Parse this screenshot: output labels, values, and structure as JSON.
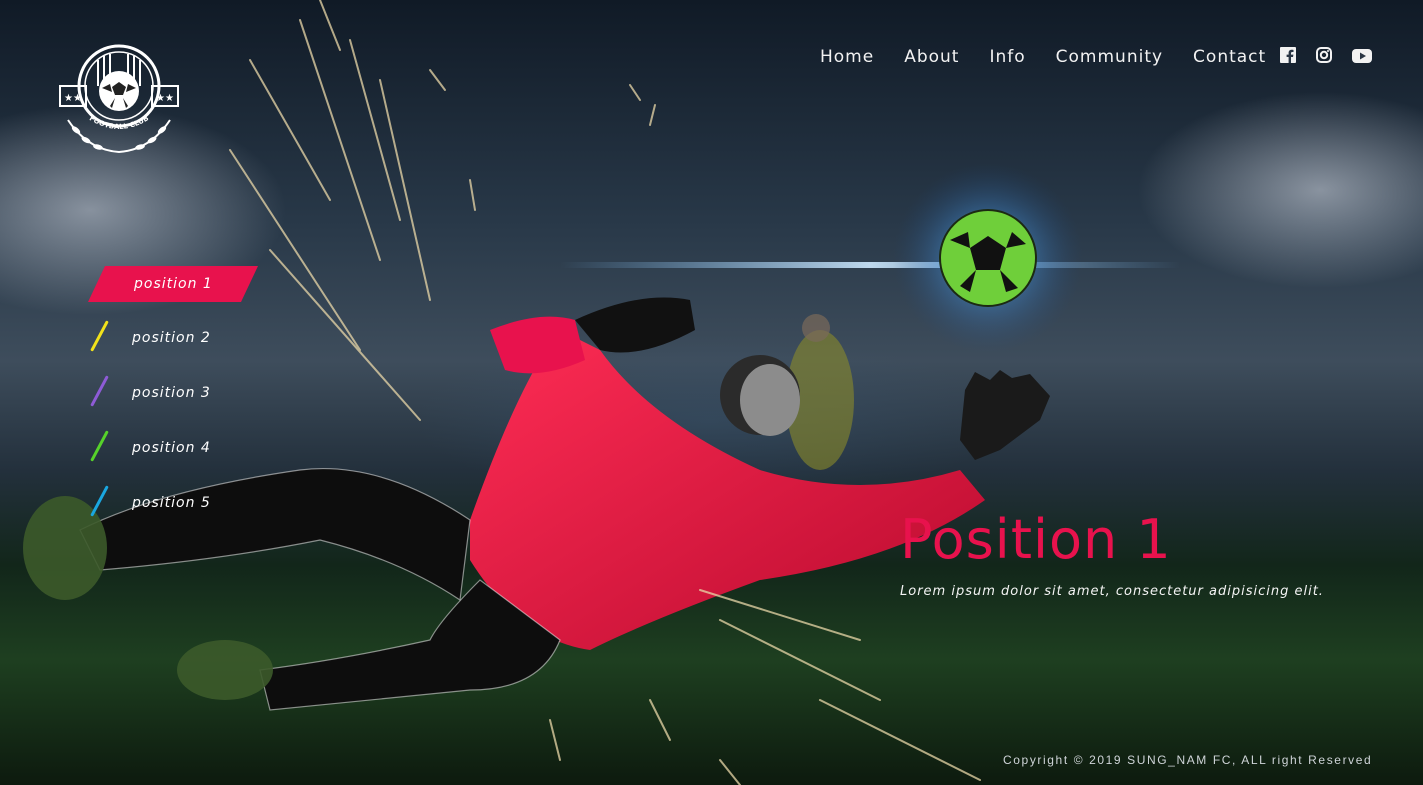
{
  "brand": {
    "logo_text": "FOOTBALL CLUB"
  },
  "nav": {
    "links": [
      "Home",
      "About",
      "Info",
      "Community",
      "Contact"
    ],
    "social_icons": [
      "facebook-icon",
      "instagram-icon",
      "youtube-icon"
    ]
  },
  "sidebar": {
    "items": [
      {
        "label": "position 1",
        "active": true,
        "accent": "#e8124d"
      },
      {
        "label": "position 2",
        "active": false,
        "accent": "#f2e21b"
      },
      {
        "label": "position 3",
        "active": false,
        "accent": "#8e5bd6"
      },
      {
        "label": "position 4",
        "active": false,
        "accent": "#56d22a"
      },
      {
        "label": "position 5",
        "active": false,
        "accent": "#1aa7e0"
      }
    ]
  },
  "hero": {
    "title": "Position 1",
    "text": "Lorem ipsum dolor sit amet, consectetur adipisicing elit."
  },
  "footer": {
    "copyright": "Copyright © 2019 SUNG_NAM FC, ALL right Reserved"
  },
  "colors": {
    "accent": "#e8124d",
    "nav_text": "#f2f2f2"
  }
}
